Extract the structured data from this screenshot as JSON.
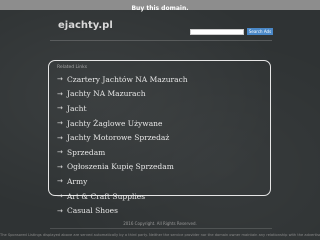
{
  "topbar": {
    "text": "Buy this domain."
  },
  "header": {
    "logo": "ejachty.pl",
    "search_placeholder": "",
    "search_button": "Search Ads"
  },
  "panel": {
    "title": "Related Links",
    "arrow": "→",
    "links": [
      {
        "label": "Czartery Jachtów NA Mazurach"
      },
      {
        "label": "Jachty NA Mazurach"
      },
      {
        "label": "Jacht"
      },
      {
        "label": "Jachty Żaglowe Używane"
      },
      {
        "label": "Jachty Motorowe Sprzedaż"
      },
      {
        "label": "Sprzedam"
      },
      {
        "label": "Ogłoszenia Kupię Sprzedam"
      },
      {
        "label": "Army"
      },
      {
        "label": "Art & Craft Supplies"
      },
      {
        "label": "Casual Shoes"
      }
    ]
  },
  "footer": {
    "copyright": "2016 Copyright. All Rights Reserved.",
    "disclaimer": "The Sponsored Listings displayed above are served automatically by a third party. Neither the service provider nor the domain owner maintain any relationship with the advertisers. In"
  },
  "colors": {
    "background": "#2f3334",
    "panel_border": "#e6e6e6",
    "button": "#4a88c7",
    "topbar": "#8d8d8d"
  }
}
